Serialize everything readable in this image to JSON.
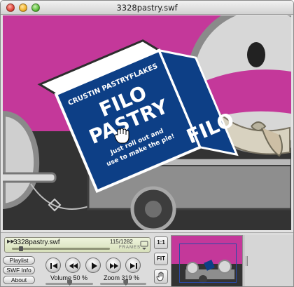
{
  "window": {
    "title": "3328pastry.swf"
  },
  "stage": {
    "box_text": {
      "brand": "CRUSTIN PASTRYFLAKES",
      "product_line1": "FILO",
      "product_line2": "PASTRY",
      "tagline_line1": "Just roll out and",
      "tagline_line2": "use to make the pie!",
      "side_text": "FILO"
    }
  },
  "controller": {
    "file_name": "3328pastry.swf",
    "frame_counter": "115/1282",
    "frames_label": "FRAMES",
    "playback_progress": 0.09,
    "buttons": {
      "playlist": "Playlist",
      "swf_info": "SWF Info",
      "about": "About",
      "actual_size": "1:1",
      "fit": "FIT"
    },
    "volume": {
      "label": "Volume 50 %",
      "level": 0.5
    },
    "zoom": {
      "label": "Zoom 319 %",
      "level": 0.55
    }
  },
  "colors": {
    "stage_background": "#c4389a",
    "box_blue": "#0d3f86",
    "ground": "#333333",
    "trailer_gray": "#8e8e8e"
  }
}
